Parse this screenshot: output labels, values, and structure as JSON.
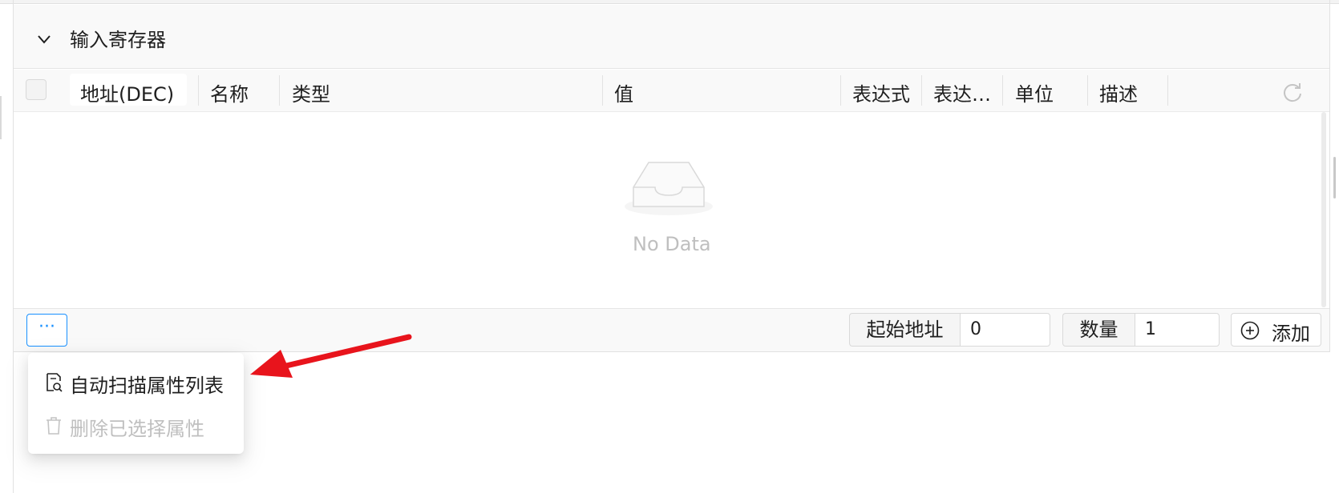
{
  "section": {
    "title": "输入寄存器"
  },
  "table": {
    "columns": [
      "地址(DEC)",
      "名称",
      "类型",
      "值",
      "表达式",
      "表达…",
      "单位",
      "描述"
    ],
    "empty_text": "No Data"
  },
  "footer": {
    "more_label": "···",
    "start_address_label": "起始地址",
    "start_address_value": "0",
    "count_label": "数量",
    "count_value": "1",
    "add_label": "添加"
  },
  "menu": {
    "items": [
      {
        "label": "自动扫描属性列表",
        "icon": "scan-doc-icon",
        "enabled": true
      },
      {
        "label": "删除已选择属性",
        "icon": "trash-icon",
        "enabled": false
      }
    ]
  },
  "colors": {
    "primary": "#1890ff",
    "arrow": "#e8141c",
    "header_bg": "#f9f9f9",
    "disabled_text": "#bfbfbf"
  }
}
